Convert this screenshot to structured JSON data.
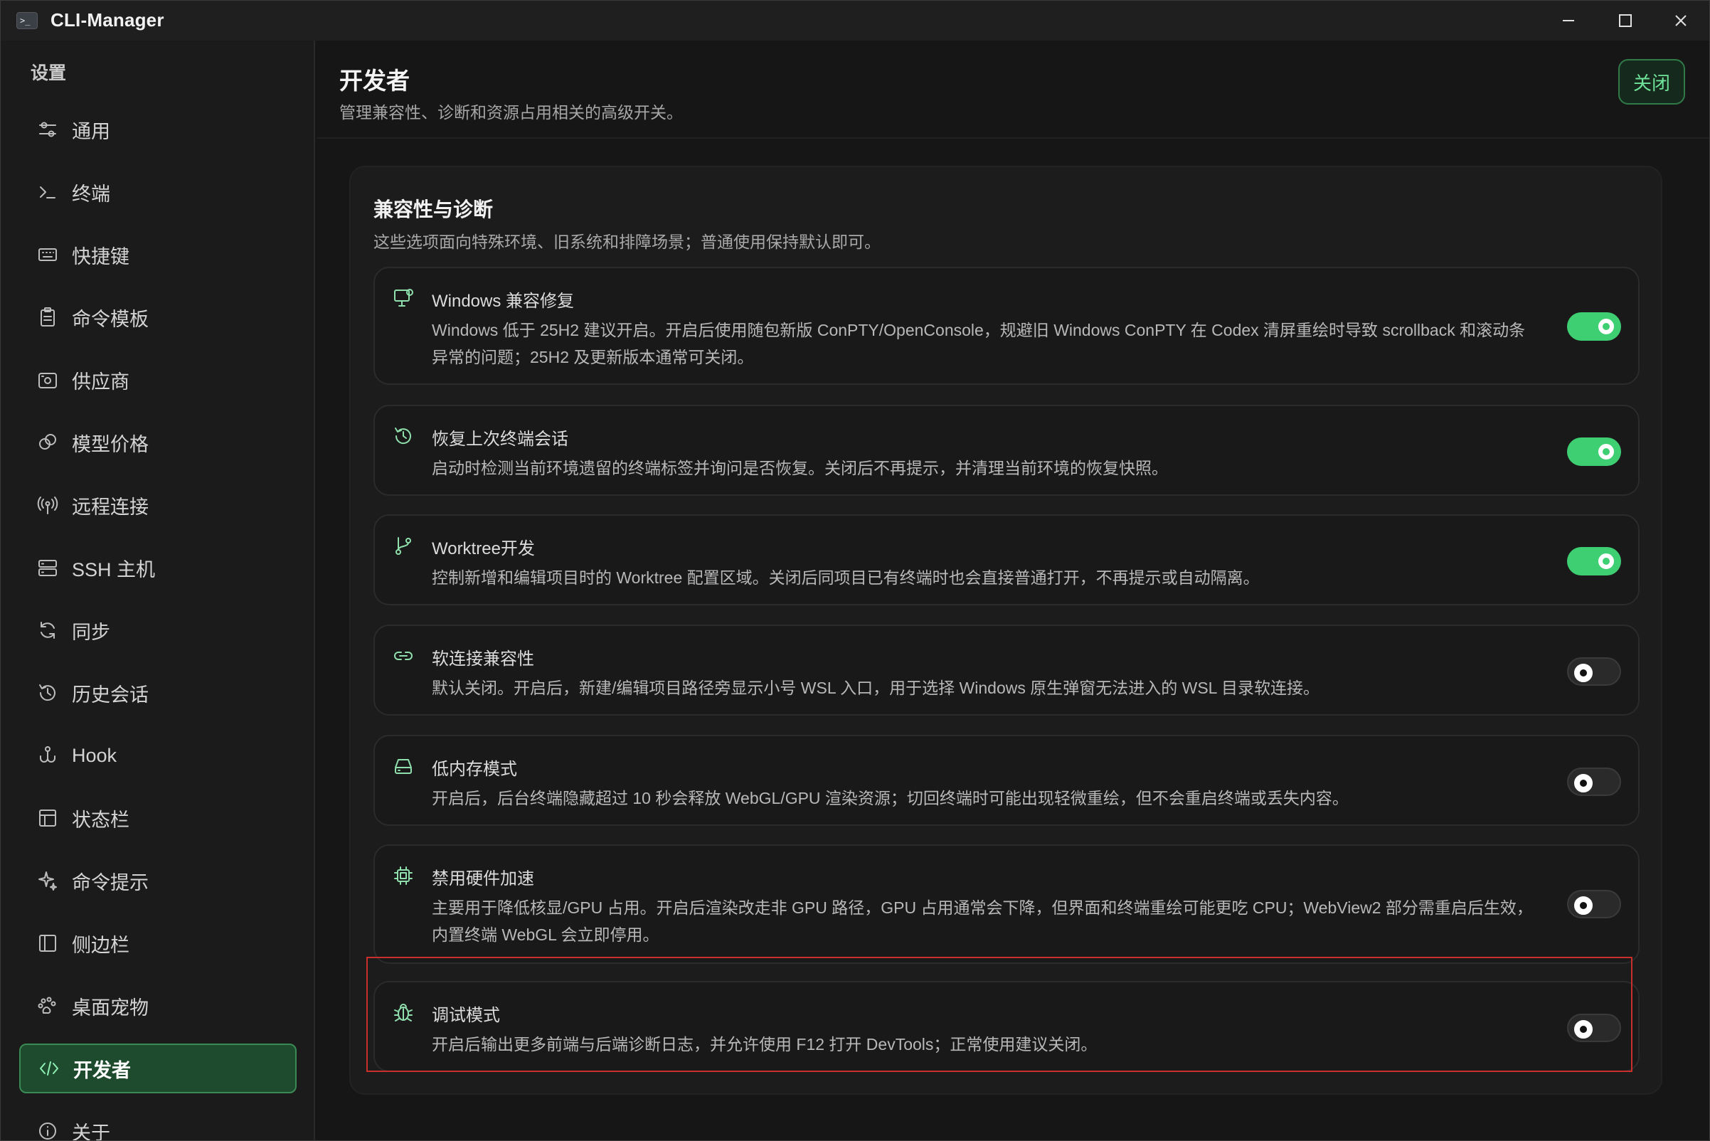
{
  "window": {
    "title": "CLI-Manager",
    "app_icon_text": ">_"
  },
  "sidebar": {
    "heading": "设置",
    "items": [
      {
        "label": "通用",
        "icon": "sliders-icon"
      },
      {
        "label": "终端",
        "icon": "terminal-icon"
      },
      {
        "label": "快捷键",
        "icon": "keyboard-icon"
      },
      {
        "label": "命令模板",
        "icon": "clipboard-icon"
      },
      {
        "label": "供应商",
        "icon": "provider-icon"
      },
      {
        "label": "模型价格",
        "icon": "price-icon"
      },
      {
        "label": "远程连接",
        "icon": "antenna-icon"
      },
      {
        "label": "SSH 主机",
        "icon": "server-icon"
      },
      {
        "label": "同步",
        "icon": "sync-icon"
      },
      {
        "label": "历史会话",
        "icon": "history-icon"
      },
      {
        "label": "Hook",
        "icon": "hook-icon"
      },
      {
        "label": "状态栏",
        "icon": "statusbar-icon"
      },
      {
        "label": "命令提示",
        "icon": "sparkle-icon"
      },
      {
        "label": "侧边栏",
        "icon": "sidebar-icon"
      },
      {
        "label": "桌面宠物",
        "icon": "paw-icon"
      },
      {
        "label": "开发者",
        "icon": "code-icon",
        "active": true
      },
      {
        "label": "关于",
        "icon": "info-icon"
      }
    ]
  },
  "header": {
    "title": "开发者",
    "subtitle": "管理兼容性、诊断和资源占用相关的高级开关。",
    "close_label": "关闭"
  },
  "section": {
    "title": "兼容性与诊断",
    "description": "这些选项面向特殊环境、旧系统和排障场景；普通使用保持默认即可。",
    "cards": [
      {
        "title": "Windows 兼容修复",
        "desc": "Windows 低于 25H2 建议开启。开启后使用随包新版 ConPTY/OpenConsole，规避旧 Windows ConPTY 在 Codex 清屏重绘时导致 scrollback 和滚动条异常的问题；25H2 及更新版本通常可关闭。",
        "enabled": true,
        "icon": "monitor-icon"
      },
      {
        "title": "恢复上次终端会话",
        "desc": "启动时检测当前环境遗留的终端标签并询问是否恢复。关闭后不再提示，并清理当前环境的恢复快照。",
        "enabled": true,
        "icon": "history-icon"
      },
      {
        "title": "Worktree开发",
        "desc": "控制新增和编辑项目时的 Worktree 配置区域。关闭后同项目已有终端时也会直接普通打开，不再提示或自动隔离。",
        "enabled": true,
        "icon": "git-branch-icon"
      },
      {
        "title": "软连接兼容性",
        "desc": "默认关闭。开启后，新建/编辑项目路径旁显示小号 WSL 入口，用于选择 Windows 原生弹窗无法进入的 WSL 目录软连接。",
        "enabled": false,
        "icon": "link-icon"
      },
      {
        "title": "低内存模式",
        "desc": "开启后，后台终端隐藏超过 10 秒会释放 WebGL/GPU 渲染资源；切回终端时可能出现轻微重绘，但不会重启终端或丢失内容。",
        "enabled": false,
        "icon": "drive-icon"
      },
      {
        "title": "禁用硬件加速",
        "desc": "主要用于降低核显/GPU 占用。开启后渲染改走非 GPU 路径，GPU 占用通常会下降，但界面和终端重绘可能更吃 CPU；WebView2 部分需重启后生效，内置终端 WebGL 会立即停用。",
        "enabled": false,
        "icon": "chip-icon"
      },
      {
        "title": "调试模式",
        "desc": "开启后输出更多前端与后端诊断日志，并允许使用 F12 打开 DevTools；正常使用建议关闭。",
        "enabled": false,
        "icon": "bug-icon"
      }
    ]
  },
  "colors": {
    "accent": "#3fcf73",
    "active_nav_bg": "#1e4a2e",
    "highlight_border": "#c9302c"
  }
}
